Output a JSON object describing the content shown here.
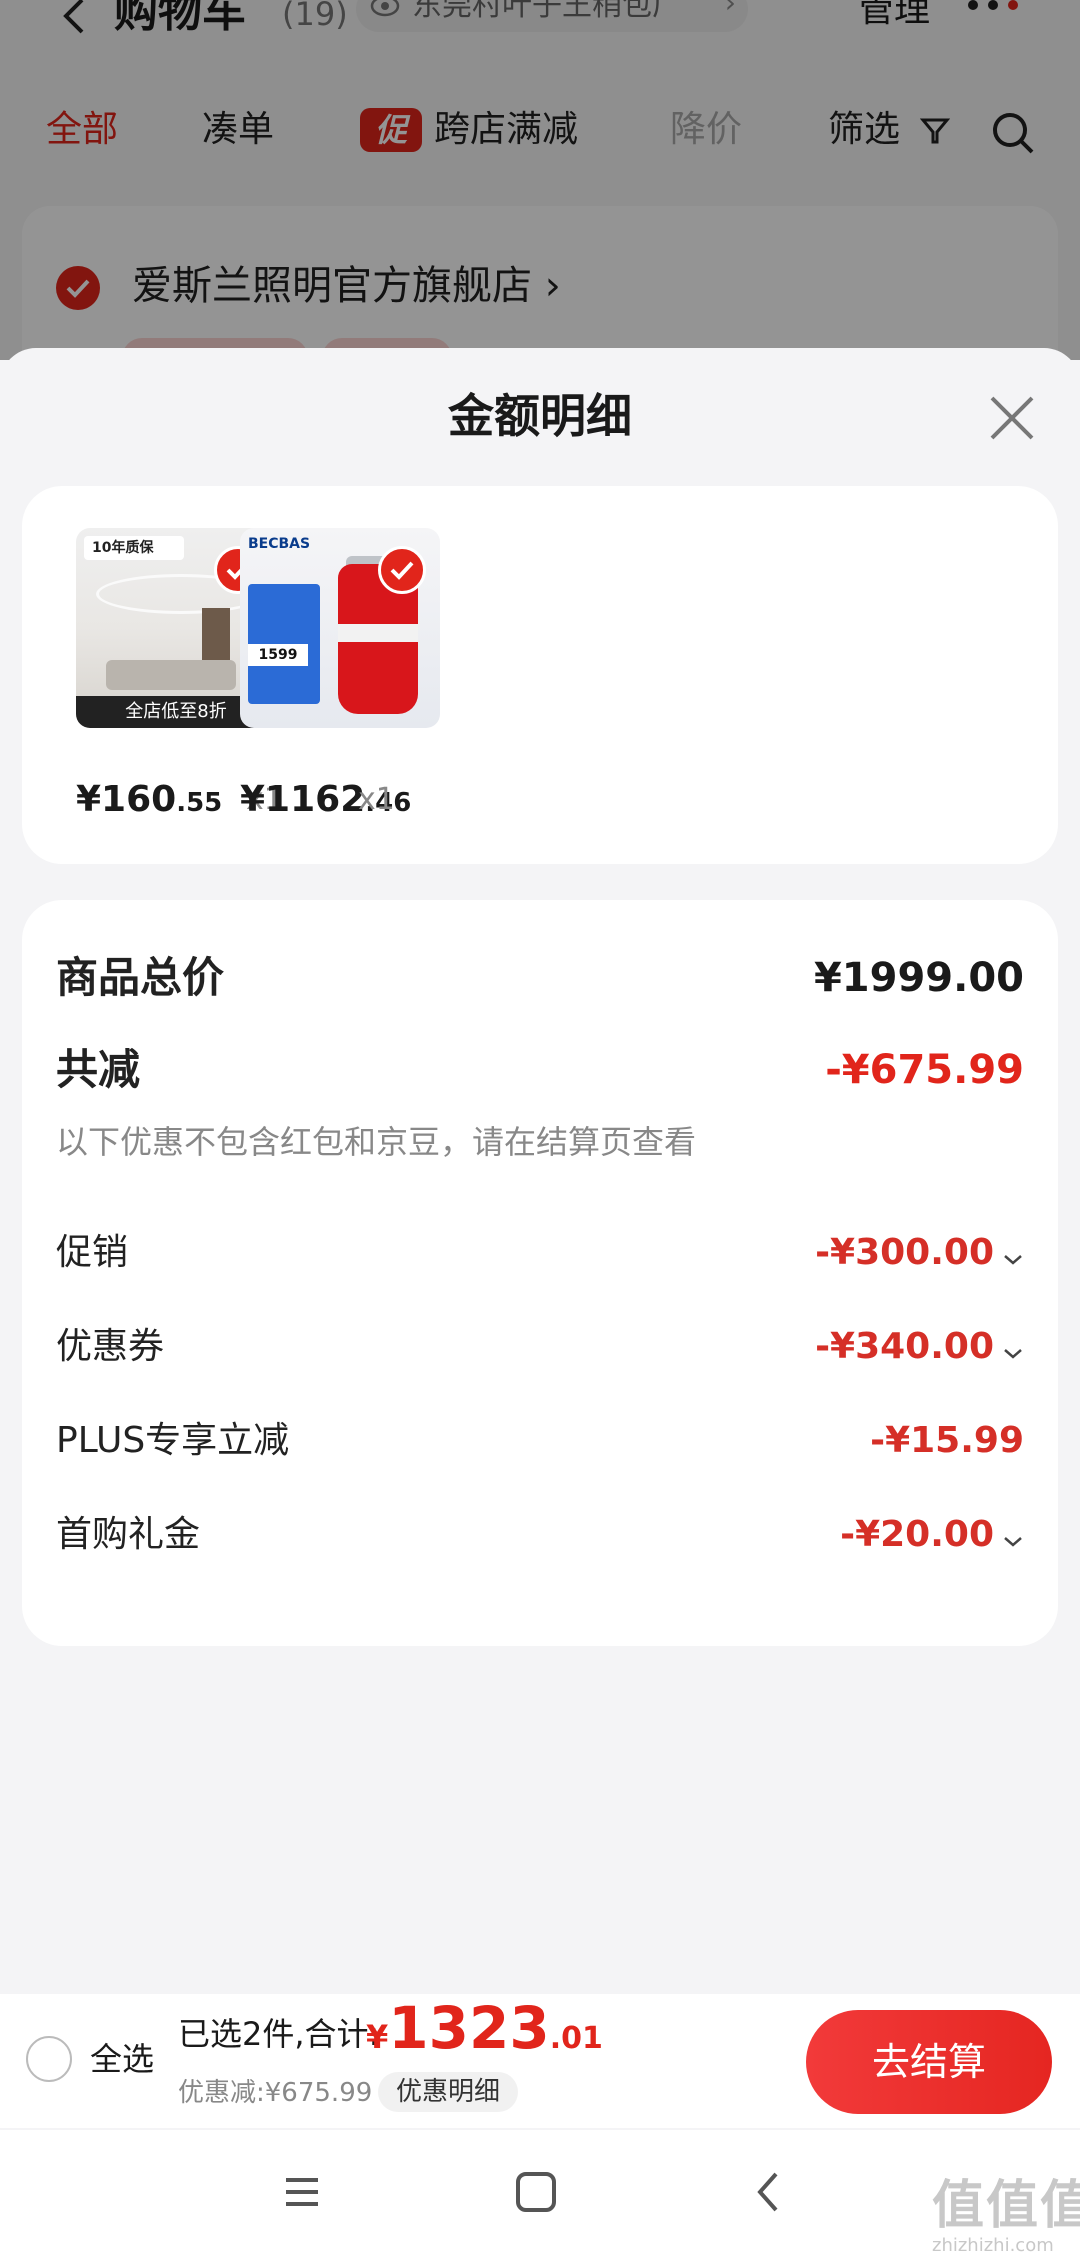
{
  "background": {
    "title": "购物车",
    "count": "(19)",
    "address": "东莞村叶子王稍包厂",
    "manage": "管理",
    "tabs": [
      {
        "label": "全部",
        "state": "active"
      },
      {
        "label": "凑单",
        "state": "normal"
      },
      {
        "label": "跨店满减",
        "state": "normal",
        "badge": "促"
      },
      {
        "label": "降价",
        "state": "muted"
      },
      {
        "label": "筛选",
        "state": "normal"
      }
    ],
    "store_name": "爱斯兰照明官方旗舰店 ›",
    "accent": "#e1251b"
  },
  "sheet": {
    "title": "金额明细",
    "products": [
      {
        "price_int": "¥160",
        "price_dec": ".55",
        "qty": "x1",
        "thumb": {
          "logo": "10年质保",
          "footer": "全店低至8折"
        }
      },
      {
        "price_int": "¥1162",
        "price_dec": ".46",
        "qty": "x1",
        "thumb": {
          "brand": "BECBAS",
          "price_tag": "1599"
        }
      }
    ],
    "summary": {
      "total_label": "商品总价",
      "total_value": "¥1999.00",
      "reduce_label": "共减",
      "reduce_value": "-¥675.99",
      "note": "以下优惠不包含红包和京豆，请在结算页查看",
      "items": [
        {
          "label": "促销",
          "value": "-¥300.00",
          "expandable": true
        },
        {
          "label": "优惠券",
          "value": "-¥340.00",
          "expandable": true
        },
        {
          "label": "PLUS专享立减",
          "value": "-¥15.99",
          "expandable": false
        },
        {
          "label": "首购礼金",
          "value": "-¥20.00",
          "expandable": true
        }
      ]
    }
  },
  "checkout": {
    "select_all": "全选",
    "selected_text": "已选2件,合计:",
    "total_yen": "¥",
    "total_int": "1323",
    "total_dec": ".01",
    "discount_text": "优惠减:¥675.99",
    "detail_button": "优惠明细",
    "checkout_button": "去结算"
  },
  "watermark": {
    "main": "值值值",
    "sub": "zhizhizhi.com"
  }
}
